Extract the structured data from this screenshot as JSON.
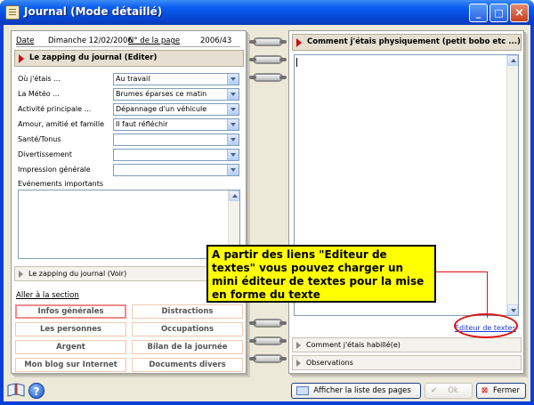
{
  "window": {
    "title": "Journal (Mode détaillé)",
    "min": "_",
    "max": "□",
    "close": "×"
  },
  "left": {
    "date_label": "Date",
    "date_value": "Dimanche 12/02/2006",
    "page_label": "N° de la page",
    "page_value": "2006/43",
    "section_title": "Le zapping du journal (Editer)",
    "fields": [
      {
        "label": "Où j'étais ...",
        "value": "Au travail"
      },
      {
        "label": "La Météo ...",
        "value": "Brumes éparses ce matin"
      },
      {
        "label": "Activité principale ...",
        "value": "Dépannage d'un véhicule"
      },
      {
        "label": "Amour, amitié et famille",
        "value": "Il faut réfléchir"
      },
      {
        "label": "Santé/Tonus",
        "value": ""
      },
      {
        "label": "Divertissement",
        "value": ""
      },
      {
        "label": "Impression générale",
        "value": ""
      }
    ],
    "events_label": "Evénements importants",
    "zapping_view": "Le zapping du journal (Voir)",
    "goto_section": "Aller à la section",
    "nav": [
      "Infos générales",
      "Distractions",
      "Les personnes",
      "Occupations",
      "Argent",
      "Bilan de la journée",
      "Mon blog sur Internet",
      "Documents divers"
    ]
  },
  "right": {
    "section_title": "Comment j'étais physiquement (petit bobo etc ...)",
    "editor_link": "Editeur de textes",
    "collapsed": [
      "Comment j'étais habillé(e)",
      "Observations"
    ]
  },
  "callout": {
    "text": "A partir des liens \"Editeur de textes\" vous pouvez charger un mini éditeur de textes pour la mise en forme du texte"
  },
  "bottom": {
    "list_button": "Afficher la liste des pages",
    "ok_button": "Ok",
    "close_button": "Fermer",
    "help": "?"
  }
}
